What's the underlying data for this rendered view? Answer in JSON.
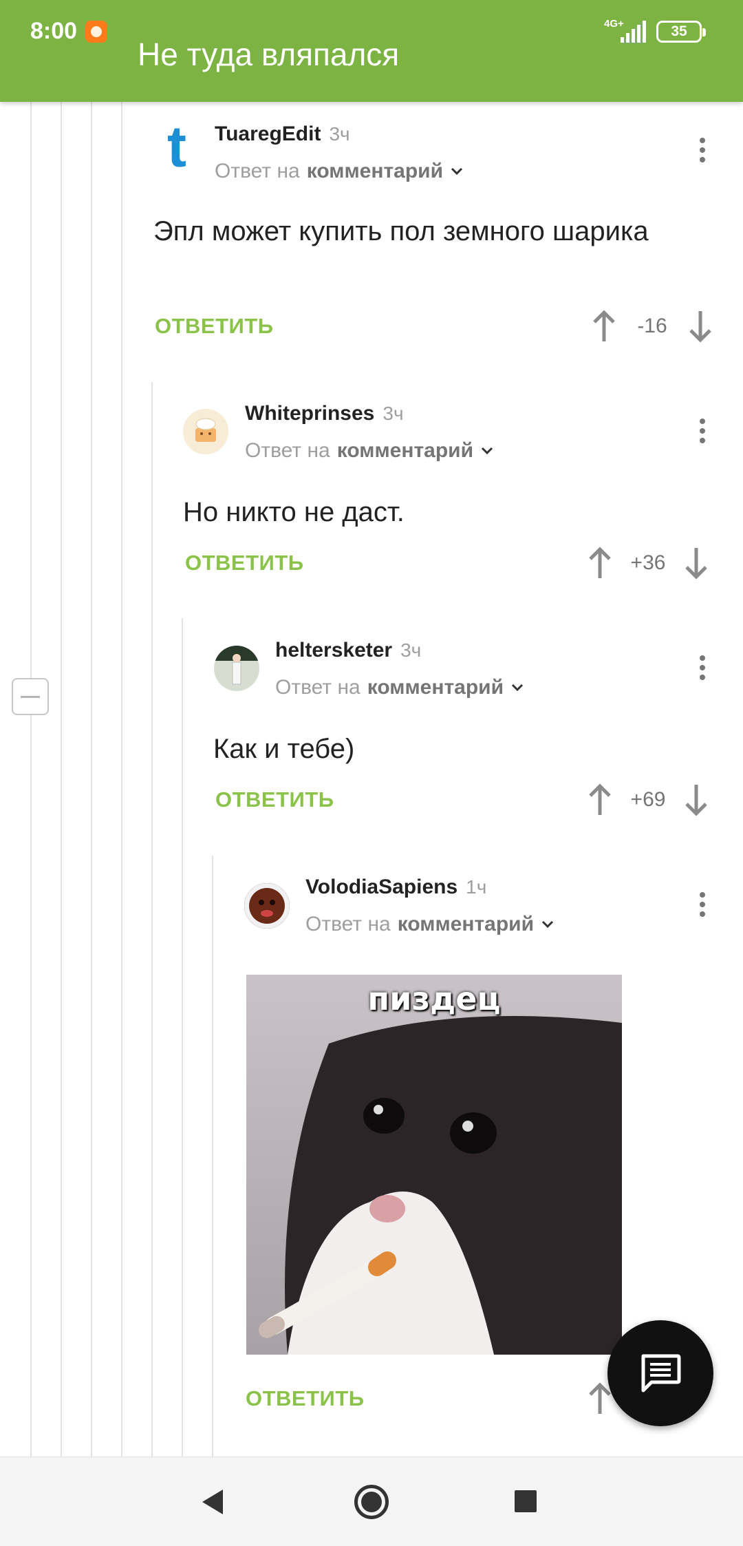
{
  "status_bar": {
    "time": "8:00",
    "network": "4G+",
    "battery": "35"
  },
  "header": {
    "title": "Не туда вляпался"
  },
  "comments": [
    {
      "author": "TuaregEdit",
      "avatar_letter": "t",
      "time": "3ч",
      "reply_prefix": "Ответ на",
      "reply_target": "комментарий",
      "text": "Эпл может купить пол земного шарика",
      "reply_label": "ОТВЕТИТЬ",
      "score": "-16"
    },
    {
      "author": "Whiteprinses",
      "time": "3ч",
      "reply_prefix": "Ответ на",
      "reply_target": "комментарий",
      "text": "Но никто не даст.",
      "reply_label": "ОТВЕТИТЬ",
      "score": "+36"
    },
    {
      "author": "heltersketer",
      "time": "3ч",
      "reply_prefix": "Ответ на",
      "reply_target": "комментарий",
      "text": "Как и тебе)",
      "reply_label": "ОТВЕТИТЬ",
      "score": "+69"
    },
    {
      "author": "VolodiaSapiens",
      "time": "1ч",
      "reply_prefix": "Ответ на",
      "reply_target": "комментарий",
      "image_caption": "пиздец",
      "reply_label": "ОТВЕТИТЬ"
    }
  ],
  "colors": {
    "header_bg": "#7cb342",
    "reply_green": "#8bc34a",
    "fab_bg": "#111111"
  },
  "icons": {
    "fab": "comment-icon",
    "nav": [
      "back-icon",
      "home-icon",
      "recents-icon"
    ]
  }
}
